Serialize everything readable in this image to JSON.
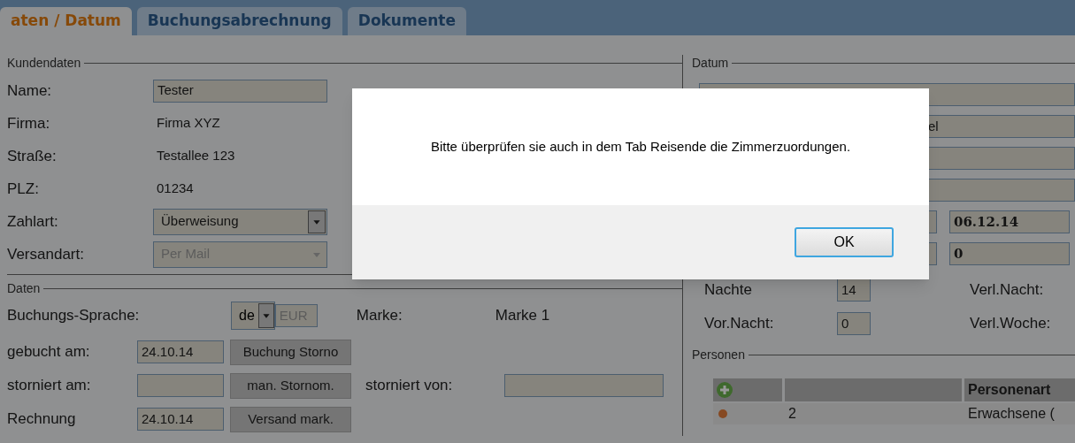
{
  "tabs": [
    {
      "label": "aten / Datum",
      "selected": true
    },
    {
      "label": "Buchungsabrechnung",
      "selected": false
    },
    {
      "label": "Dokumente",
      "selected": false
    }
  ],
  "kundendaten": {
    "legend": "Kundendaten",
    "rows": [
      {
        "kind": "input",
        "label": "Name:",
        "value": "Tester"
      },
      {
        "kind": "text",
        "label": "Firma:",
        "value": "Firma XYZ"
      },
      {
        "kind": "text",
        "label": "Straße:",
        "value": "Testallee 123"
      },
      {
        "kind": "text",
        "label": "PLZ:",
        "value": "01234"
      },
      {
        "kind": "select",
        "label": "Zahlart:",
        "value": "Überweisung",
        "disabled": false
      },
      {
        "kind": "select",
        "label": "Versandart:",
        "value": "Per Mail",
        "disabled": true
      }
    ]
  },
  "daten": {
    "legend": "Daten",
    "sprache_label": "Buchungs-Sprache:",
    "sprache_value": "de",
    "currency": "EUR",
    "marke_label": "Marke:",
    "marke_value": "Marke 1",
    "rows": [
      {
        "label": "gebucht am:",
        "value": "24.10.14",
        "button": "Buchung Storno"
      },
      {
        "label": "storniert am:",
        "value": "",
        "button": "man. Stornom.",
        "extra_label": "storniert von:"
      },
      {
        "label": "Rechnung",
        "value": "24.10.14",
        "button": "Versand mark."
      }
    ]
  },
  "datum": {
    "legend": "Datum",
    "partial_field": "el",
    "date_value": "06.12.14",
    "count_value": "0",
    "stats": [
      {
        "label": "Nachte",
        "value": "14",
        "right_label": "Verl.Nacht:"
      },
      {
        "label": "Vor.Nacht:",
        "value": "0",
        "right_label": "Verl.Woche:"
      }
    ]
  },
  "personen": {
    "legend": "Personen",
    "column_3": "Personenart",
    "rows": [
      {
        "column_2": "2",
        "column_3": "Erwachsene ("
      }
    ]
  },
  "dialog": {
    "message": "Bitte überprüfen sie auch in dem Tab Reisende die Zimmerzuordungen.",
    "button": "OK"
  }
}
